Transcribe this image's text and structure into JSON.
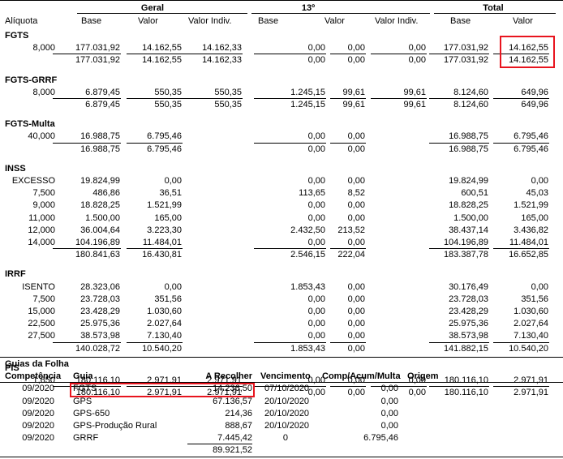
{
  "headers": {
    "geral": "Geral",
    "decimo": "13º",
    "total": "Total",
    "aliquota": "Alíquota",
    "base": "Base",
    "valor": "Valor",
    "valor_indiv": "Valor Indiv."
  },
  "sections": [
    {
      "title": "FGTS",
      "rows": [
        [
          "8,000",
          "177.031,92",
          "14.162,55",
          "14.162,33",
          "0,00",
          "0,00",
          "0,00",
          "177.031,92",
          "14.162,55"
        ]
      ],
      "totals": [
        "177.031,92",
        "14.162,55",
        "14.162,33",
        "0,00",
        "0,00",
        "0,00",
        "177.031,92",
        "14.162,55"
      ]
    },
    {
      "title": "FGTS-GRRF",
      "rows": [
        [
          "8,000",
          "6.879,45",
          "550,35",
          "550,35",
          "1.245,15",
          "99,61",
          "99,61",
          "8.124,60",
          "649,96"
        ]
      ],
      "totals": [
        "6.879,45",
        "550,35",
        "550,35",
        "1.245,15",
        "99,61",
        "99,61",
        "8.124,60",
        "649,96"
      ]
    },
    {
      "title": "FGTS-Multa",
      "rows": [
        [
          "40,000",
          "16.988,75",
          "6.795,46",
          "",
          "0,00",
          "0,00",
          "",
          "16.988,75",
          "6.795,46"
        ]
      ],
      "totals": [
        "16.988,75",
        "6.795,46",
        "",
        "0,00",
        "0,00",
        "",
        "16.988,75",
        "6.795,46"
      ]
    },
    {
      "title": "INSS",
      "rows": [
        [
          "EXCESSO",
          "19.824,99",
          "0,00",
          "",
          "0,00",
          "0,00",
          "",
          "19.824,99",
          "0,00"
        ],
        [
          "7,500",
          "486,86",
          "36,51",
          "",
          "113,65",
          "8,52",
          "",
          "600,51",
          "45,03"
        ],
        [
          "9,000",
          "18.828,25",
          "1.521,99",
          "",
          "0,00",
          "0,00",
          "",
          "18.828,25",
          "1.521,99"
        ],
        [
          "11,000",
          "1.500,00",
          "165,00",
          "",
          "0,00",
          "0,00",
          "",
          "1.500,00",
          "165,00"
        ],
        [
          "12,000",
          "36.004,64",
          "3.223,30",
          "",
          "2.432,50",
          "213,52",
          "",
          "38.437,14",
          "3.436,82"
        ],
        [
          "14,000",
          "104.196,89",
          "11.484,01",
          "",
          "0,00",
          "0,00",
          "",
          "104.196,89",
          "11.484,01"
        ]
      ],
      "totals": [
        "180.841,63",
        "16.430,81",
        "",
        "2.546,15",
        "222,04",
        "",
        "183.387,78",
        "16.652,85"
      ]
    },
    {
      "title": "IRRF",
      "rows": [
        [
          "ISENTO",
          "28.323,06",
          "0,00",
          "",
          "1.853,43",
          "0,00",
          "",
          "30.176,49",
          "0,00"
        ],
        [
          "7,500",
          "23.728,03",
          "351,56",
          "",
          "0,00",
          "0,00",
          "",
          "23.728,03",
          "351,56"
        ],
        [
          "15,000",
          "23.428,29",
          "1.030,60",
          "",
          "0,00",
          "0,00",
          "",
          "23.428,29",
          "1.030,60"
        ],
        [
          "22,500",
          "25.975,36",
          "2.027,64",
          "",
          "0,00",
          "0,00",
          "",
          "25.975,36",
          "2.027,64"
        ],
        [
          "27,500",
          "38.573,98",
          "7.130,40",
          "",
          "0,00",
          "0,00",
          "",
          "38.573,98",
          "7.130,40"
        ]
      ],
      "totals": [
        "140.028,72",
        "10.540,20",
        "",
        "1.853,43",
        "0,00",
        "",
        "141.882,15",
        "10.540,20"
      ]
    },
    {
      "title": "PIS",
      "rows": [
        [
          "1,650",
          "180.116,10",
          "2.971,91",
          "2.971,91",
          "0,00",
          "0,00",
          "0,00",
          "180.116,10",
          "2.971,91"
        ]
      ],
      "totals": [
        "180.116,10",
        "2.971,91",
        "2.971,91",
        "0,00",
        "0,00",
        "0,00",
        "180.116,10",
        "2.971,91"
      ]
    }
  ],
  "guias": {
    "title": "Guias da Folha",
    "headers": {
      "competencia": "Competência",
      "guia": "Guia",
      "a_recolher": "A Recolher",
      "vencimento": "Vencimento",
      "comp": "Comp/Acum/Multa",
      "origem": "Origem"
    },
    "rows": [
      [
        "09/2020",
        "FGTS",
        "14.236,50",
        "07/10/2020",
        "0,00"
      ],
      [
        "09/2020",
        "GPS",
        "67.136,57",
        "20/10/2020",
        "0,00"
      ],
      [
        "09/2020",
        "GPS-650",
        "214,36",
        "20/10/2020",
        "0,00"
      ],
      [
        "09/2020",
        "GPS-Produção Rural",
        "888,67",
        "20/10/2020",
        "0,00"
      ],
      [
        "09/2020",
        "GRRF",
        "7.445,42",
        "0",
        "6.795,46"
      ]
    ],
    "total": "89.921,52"
  },
  "colors": {
    "highlight": "#e8141e"
  }
}
